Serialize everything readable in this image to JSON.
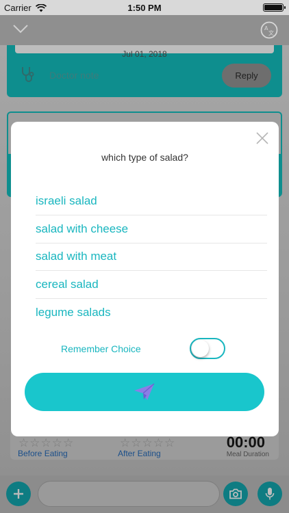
{
  "status_bar": {
    "carrier": "Carrier",
    "time": "1:50 PM"
  },
  "note": {
    "date": "Jul 01, 2018",
    "doctor_note": "Doctor note",
    "reply": "Reply"
  },
  "modal": {
    "question": "which type of salad?",
    "options": [
      "israeli salad",
      "salad with cheese",
      "salad with meat",
      "cereal salad",
      "legume salads"
    ],
    "remember_label": "Remember Choice",
    "remember_on": false
  },
  "rating": {
    "before_label": "Before Eating",
    "after_label": "After Eating",
    "stars": "☆☆☆☆☆"
  },
  "meal": {
    "duration": "00:00",
    "duration_label": "Meal Duration"
  },
  "colors": {
    "accent": "#19c6cc",
    "teal_dark": "#0e8e8e",
    "send_icon": "#8b7ee6"
  }
}
